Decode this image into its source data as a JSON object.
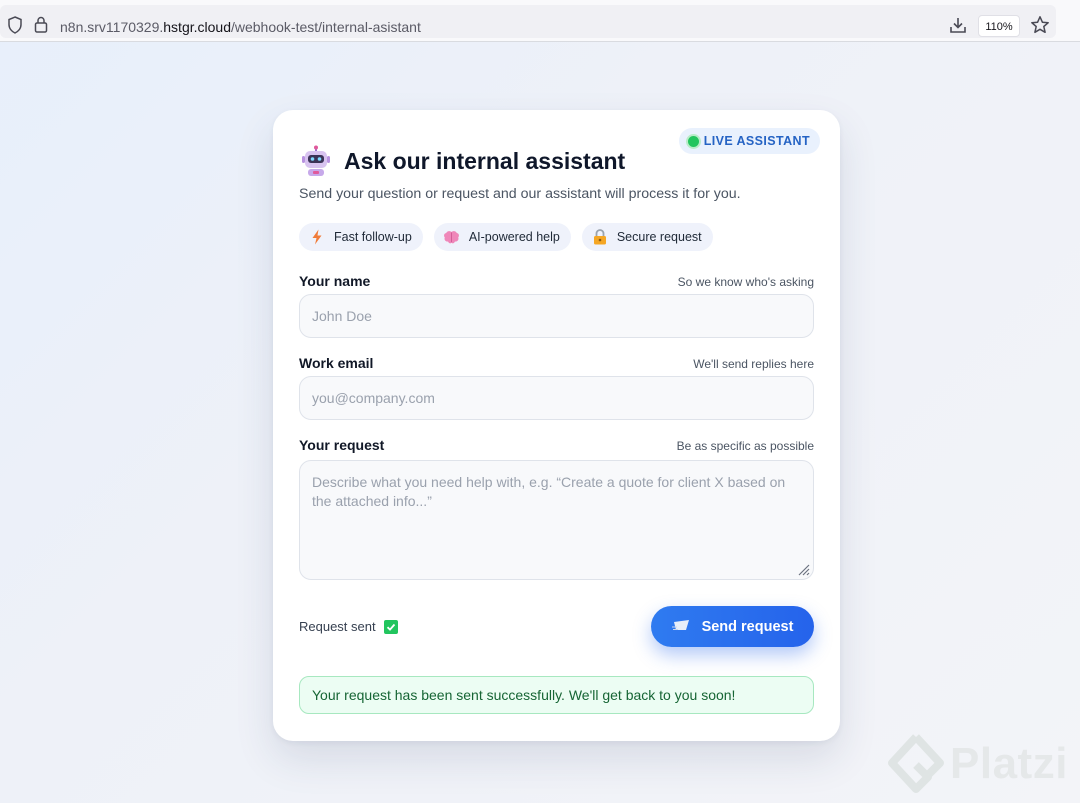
{
  "browser": {
    "url_prefix": "n8n.srv1170329.",
    "url_domain": "hstgr.cloud",
    "url_path": "/webhook-test/internal-asistant",
    "zoom": "110%"
  },
  "card": {
    "live_badge": "LIVE ASSISTANT",
    "title": "Ask our internal assistant",
    "subtitle": "Send your question or request and our assistant will process it for you.",
    "chips": [
      {
        "label": "Fast follow-up",
        "icon": "lightning-icon"
      },
      {
        "label": "AI-powered help",
        "icon": "brain-icon"
      },
      {
        "label": "Secure request",
        "icon": "lock-icon"
      }
    ],
    "fields": {
      "name": {
        "label": "Your name",
        "hint": "So we know who's asking",
        "placeholder": "John Doe",
        "value": ""
      },
      "email": {
        "label": "Work email",
        "hint": "We'll send replies here",
        "placeholder": "you@company.com",
        "value": ""
      },
      "request": {
        "label": "Your request",
        "hint": "Be as specific as possible",
        "placeholder": "Describe what you need help with, e.g. “Create a quote for client X based on the attached info...”",
        "value": ""
      }
    },
    "status": "Request sent",
    "send_label": "Send request",
    "success_message": "Your request has been sent successfully. We'll get back to you soon!"
  },
  "watermark": "Platzi",
  "colors": {
    "accent": "#2563eb",
    "live_dot": "#22c55e",
    "success_bg": "#ecfdf3",
    "success_text": "#166534"
  }
}
